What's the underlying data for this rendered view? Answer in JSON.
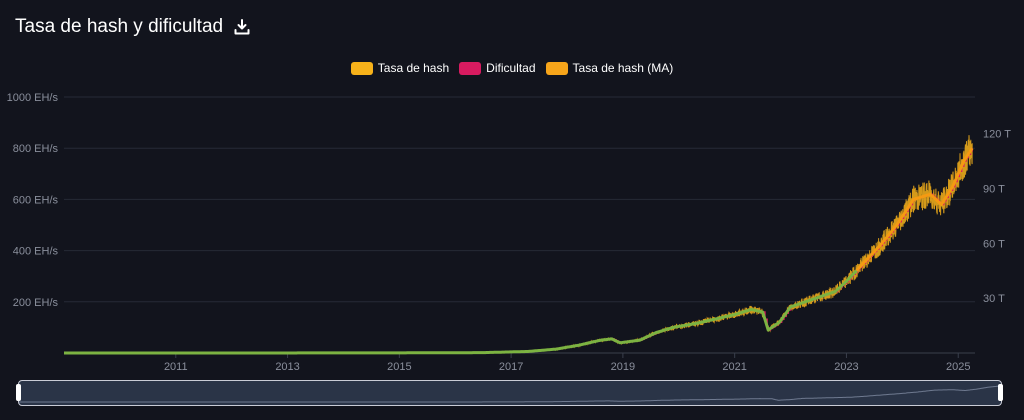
{
  "header": {
    "title": "Tasa de hash y dificultad",
    "download_icon": "download-icon"
  },
  "legend": [
    {
      "label": "Tasa de hash",
      "color": "#f7b21a"
    },
    {
      "label": "Dificultad",
      "color": "#d81b60"
    },
    {
      "label": "Tasa de hash (MA)",
      "color": "#f7a51a"
    }
  ],
  "colors": {
    "background": "#12141d",
    "hashrate": "#f7b21a",
    "hashrate_ma": "#f59a12",
    "difficulty": "#d81b60",
    "early_line": "#7cb342",
    "grid": "#262a36"
  },
  "chart_data": {
    "type": "line",
    "x_ticks": [
      "2011",
      "2013",
      "2015",
      "2017",
      "2019",
      "2021",
      "2023",
      "2025"
    ],
    "y_left_ticks": [
      "200 EH/s",
      "400 EH/s",
      "600 EH/s",
      "800 EH/s",
      "1000 EH/s"
    ],
    "y_right_ticks": [
      "30 T",
      "60 T",
      "90 T",
      "120 T"
    ],
    "ylim_left": [
      0,
      1000
    ],
    "ylim_right": [
      0,
      140
    ],
    "xlim": [
      2009.0,
      2025.3
    ],
    "grid": true,
    "legend_position": "top-center",
    "series": [
      {
        "name": "Tasa de hash",
        "axis": "left",
        "x": [
          2009.0,
          2012.0,
          2015.0,
          2016.5,
          2017.3,
          2017.8,
          2018.2,
          2018.6,
          2018.8,
          2018.95,
          2019.3,
          2019.6,
          2019.9,
          2020.3,
          2020.7,
          2021.0,
          2021.3,
          2021.5,
          2021.6,
          2021.8,
          2022.0,
          2022.4,
          2022.8,
          2023.0,
          2023.3,
          2023.6,
          2023.9,
          2024.2,
          2024.5,
          2024.7,
          2024.9,
          2025.1,
          2025.25
        ],
        "y": [
          0,
          0,
          0.5,
          1.5,
          6,
          15,
          30,
          50,
          55,
          40,
          50,
          80,
          100,
          115,
          135,
          150,
          170,
          160,
          90,
          120,
          180,
          210,
          240,
          280,
          350,
          420,
          500,
          600,
          620,
          580,
          650,
          750,
          800
        ]
      },
      {
        "name": "Tasa de hash (MA)",
        "axis": "left",
        "x": [
          2009.0,
          2012.0,
          2015.0,
          2016.5,
          2017.3,
          2017.8,
          2018.2,
          2018.6,
          2018.8,
          2018.95,
          2019.3,
          2019.6,
          2019.9,
          2020.3,
          2020.7,
          2021.0,
          2021.3,
          2021.5,
          2021.6,
          2021.8,
          2022.0,
          2022.4,
          2022.8,
          2023.0,
          2023.3,
          2023.6,
          2023.9,
          2024.2,
          2024.5,
          2024.7,
          2024.9,
          2025.1,
          2025.25
        ],
        "y": [
          0,
          0,
          0.5,
          1.5,
          6,
          15,
          30,
          50,
          55,
          40,
          50,
          80,
          100,
          115,
          135,
          150,
          170,
          160,
          90,
          120,
          180,
          210,
          240,
          280,
          350,
          420,
          500,
          600,
          620,
          580,
          650,
          750,
          800
        ]
      },
      {
        "name": "Dificultad",
        "axis": "right",
        "x": [
          2009.0,
          2012.0,
          2015.0,
          2016.5,
          2017.3,
          2017.8,
          2018.2,
          2018.6,
          2018.8,
          2018.95,
          2019.3,
          2019.6,
          2019.9,
          2020.3,
          2020.7,
          2021.0,
          2021.3,
          2021.5,
          2021.6,
          2021.8,
          2022.0,
          2022.4,
          2022.8,
          2023.0,
          2023.3,
          2023.6,
          2023.9,
          2024.2,
          2024.5,
          2024.7,
          2024.9,
          2025.1,
          2025.25
        ],
        "y": [
          0,
          0,
          0.07,
          0.2,
          0.8,
          2,
          4.2,
          7,
          7.7,
          5.6,
          7,
          11.2,
          14,
          16.1,
          18.9,
          21,
          23.8,
          22.4,
          12.6,
          16.8,
          25.2,
          29.4,
          33.6,
          39.2,
          49,
          58.8,
          70,
          84,
          86.8,
          81.2,
          91,
          105,
          112
        ]
      }
    ]
  }
}
